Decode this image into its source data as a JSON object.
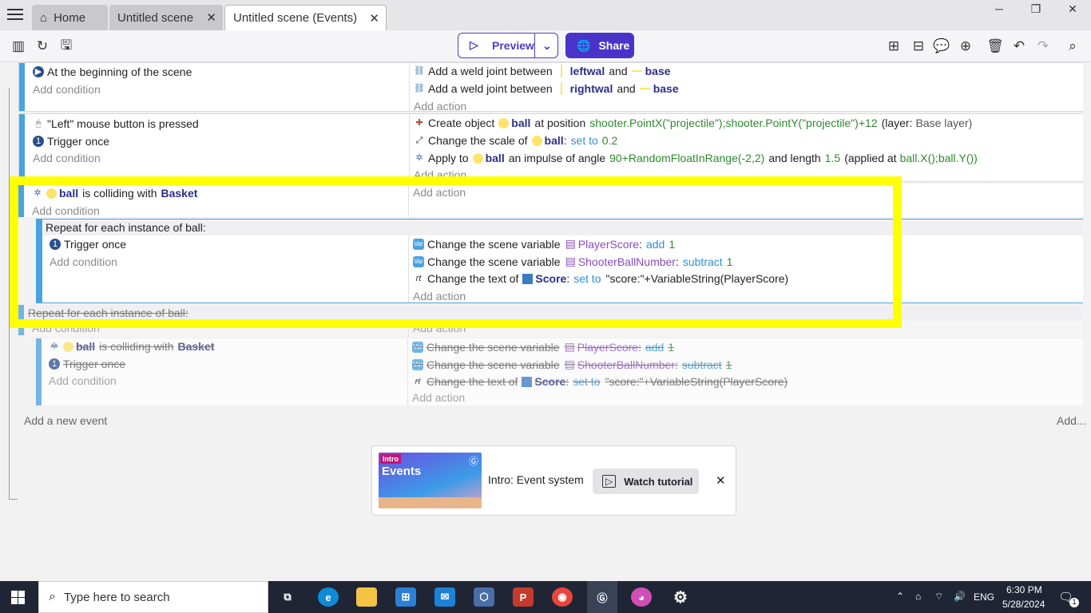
{
  "tabs": [
    {
      "label": "Home"
    },
    {
      "label": "Untitled scene"
    },
    {
      "label": "Untitled scene (Events)"
    }
  ],
  "toolbar": {
    "preview_label": "Preview",
    "share_label": "Share"
  },
  "events": {
    "e1": {
      "conditions": [
        "At the beginning of the scene"
      ],
      "add_condition": "Add condition",
      "actions": [
        {
          "pre": "Add a weld joint between",
          "a": "leftwal",
          "mid": "and",
          "b": "base"
        },
        {
          "pre": "Add a weld joint between",
          "a": "rightwal",
          "mid": "and",
          "b": "base"
        }
      ],
      "add_action": "Add action"
    },
    "e2": {
      "conditions": [
        "\"Left\" mouse button is pressed",
        "Trigger once"
      ],
      "add_condition": "Add condition",
      "a1": {
        "pre": "Create object",
        "obj": "ball",
        "mid": "at position",
        "pos": "shooter.PointX(\"projectile\");shooter.PointY(\"projectile\")+12",
        "layer": "(layer:",
        "layerval": "Base layer)"
      },
      "a2": {
        "pre": "Change the scale of",
        "obj": "ball",
        "colon": ":",
        "op": "set to",
        "val": "0.2"
      },
      "a3": {
        "pre": "Apply to",
        "obj": "ball",
        "mid": "an impulse of angle",
        "angle": "90+RandomFloatInRange(-2,2)",
        "mid2": "and length",
        "len": "1.5",
        "mid3": "(applied at",
        "at": "ball.X();ball.Y())"
      },
      "add_action": "Add action"
    },
    "e3": {
      "cond_obj": "ball",
      "cond_mid": "is colliding with",
      "cond_target": "Basket",
      "add_condition": "Add condition",
      "add_action": "Add action",
      "sub_title": "Repeat for each instance of ball:",
      "sub_cond": "Trigger once",
      "sub_add_condition": "Add condition",
      "sa1": {
        "pre": "Change the scene variable",
        "var": "PlayerScore",
        "colon": ":",
        "op": "add",
        "val": "1"
      },
      "sa2": {
        "pre": "Change the scene variable",
        "var": "ShooterBallNumber",
        "colon": ":",
        "op": "subtract",
        "val": "1"
      },
      "sa3": {
        "pre": "Change the text of",
        "obj": "Score",
        "colon": ":",
        "op": "set to",
        "val": "\"score:\"+VariableString(PlayerScore)"
      },
      "sub_add_action": "Add action"
    },
    "e4": {
      "title": "Repeat for each instance of ball:",
      "add_condition": "Add condition",
      "add_action": "Add action",
      "sub_cond_obj": "ball",
      "sub_cond_mid": "is colliding with",
      "sub_cond_target": "Basket",
      "sub_cond2": "Trigger once",
      "sub_add_condition": "Add condition",
      "sa1": {
        "pre": "Change the scene variable",
        "var": "PlayerScore",
        "colon": ":",
        "op": "add",
        "val": "1"
      },
      "sa2": {
        "pre": "Change the scene variable",
        "var": "ShooterBallNumber",
        "colon": ":",
        "op": "subtract",
        "val": "1"
      },
      "sa3": {
        "pre": "Change the text of",
        "obj": "Score",
        "colon": ":",
        "op": "set to",
        "val": "\"score:\"+VariableString(PlayerScore)"
      },
      "sub_add_action": "Add action"
    },
    "add_new_event": "Add a new event",
    "add_more": "Add..."
  },
  "tutorial": {
    "badge": "Intro",
    "thumb_title": "Events",
    "label": "Intro: Event system",
    "button": "Watch tutorial"
  },
  "taskbar": {
    "search_placeholder": "Type here to search",
    "lang": "ENG",
    "time": "6:30 PM",
    "date": "5/28/2024",
    "notif_count": "1"
  },
  "colors": {
    "accent": "#4a33c8",
    "event_bar": "#4aa3df",
    "highlight": "#ffff00"
  }
}
